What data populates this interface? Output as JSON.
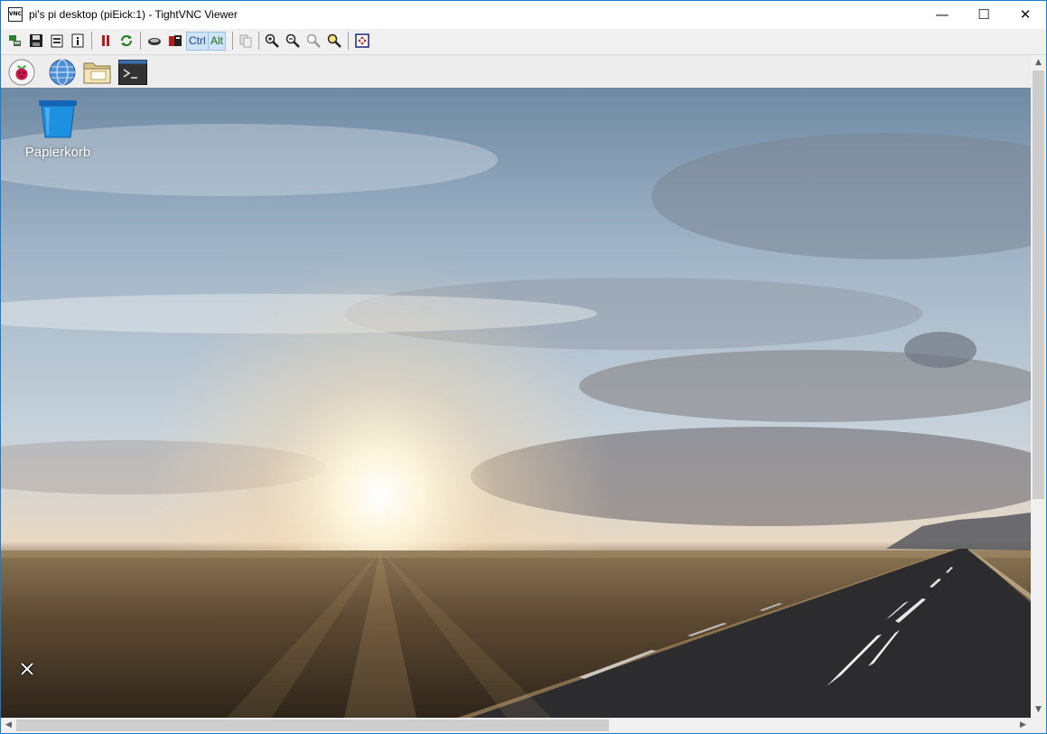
{
  "window": {
    "title": "pi's pi desktop (piEick:1) - TightVNC Viewer",
    "app_icon_text": "VNC",
    "minimize_symbol": "—",
    "maximize_symbol": "☐",
    "close_symbol": "✕"
  },
  "toolbar": {
    "ctrl_label": "Ctrl",
    "alt_label": "Alt",
    "buttons": [
      {
        "icon": "new-connection-icon"
      },
      {
        "icon": "save-icon"
      },
      {
        "icon": "options-icon"
      },
      {
        "icon": "connection-info-icon"
      },
      {
        "icon": "pause-icon"
      },
      {
        "icon": "refresh-icon"
      },
      {
        "icon": "send-ctrl-alt-del-icon"
      },
      {
        "icon": "send-ctrl-esc-icon"
      },
      {
        "icon": "transfer-files-icon"
      },
      {
        "icon": "zoom-in-icon"
      },
      {
        "icon": "zoom-out-icon"
      },
      {
        "icon": "zoom-100-icon"
      },
      {
        "icon": "zoom-auto-icon"
      },
      {
        "icon": "fullscreen-icon"
      }
    ]
  },
  "remote_taskbar": {
    "launchers": [
      "raspberry-menu-icon",
      "web-browser-icon",
      "file-manager-icon",
      "terminal-icon"
    ]
  },
  "desktop": {
    "icons": [
      {
        "label": "Papierkorb",
        "icon": "trash-bin-icon"
      }
    ]
  },
  "colors": {
    "accent": "#1979ca",
    "trash_blue": "#1e90e0"
  }
}
